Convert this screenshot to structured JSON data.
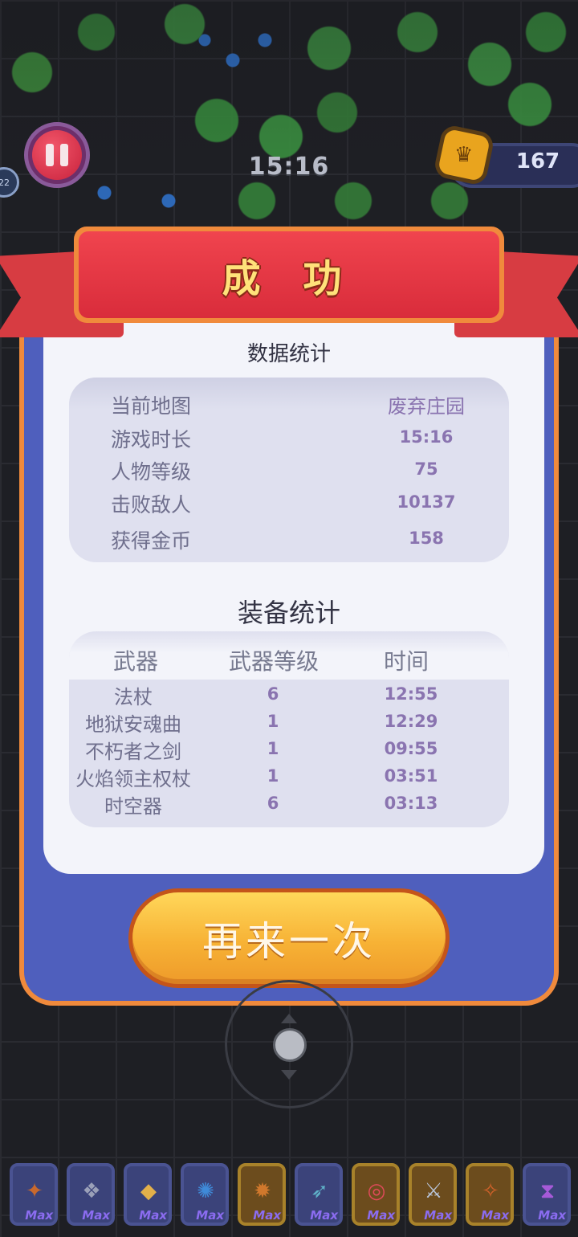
{
  "hud": {
    "timer": "15:16",
    "coins": "167",
    "side_chip": "22"
  },
  "result": {
    "title": "成 功",
    "stats_title": "数据统计",
    "stats": [
      {
        "label": "当前地图",
        "value": "废弃庄园"
      },
      {
        "label": "游戏时长",
        "value": "15:16"
      },
      {
        "label": "人物等级",
        "value": "75"
      },
      {
        "label": "击败敌人",
        "value": "10137"
      },
      {
        "label": "获得金币",
        "value": "158"
      }
    ],
    "equip_title": "装备统计",
    "equip_headers": [
      "武器",
      "武器等级",
      "时间"
    ],
    "equip_rows": [
      {
        "name": "法杖",
        "level": "6",
        "time": "12:55"
      },
      {
        "name": "地狱安魂曲",
        "level": "1",
        "time": "12:29"
      },
      {
        "name": "不朽者之剑",
        "level": "1",
        "time": "09:55"
      },
      {
        "name": "火焰领主权杖",
        "level": "1",
        "time": "03:51"
      },
      {
        "name": "时空器",
        "level": "6",
        "time": "03:13"
      }
    ],
    "again_label": "再来一次"
  },
  "skills": [
    {
      "icon": "boot-icon",
      "glyph": "✦",
      "max": "Max",
      "style": "blue",
      "color": "#c9692d"
    },
    {
      "icon": "wings-icon",
      "glyph": "❖",
      "max": "Max",
      "style": "blue",
      "color": "#9aa0b8"
    },
    {
      "icon": "crystal-icon",
      "glyph": "◆",
      "max": "Max",
      "style": "blue",
      "color": "#e3b04a"
    },
    {
      "icon": "vortex-icon",
      "glyph": "✺",
      "max": "Max",
      "style": "blue",
      "color": "#3f8ad8"
    },
    {
      "icon": "sun-orb-icon",
      "glyph": "✹",
      "max": "Max",
      "style": "gold",
      "color": "#d0782c"
    },
    {
      "icon": "spear-icon",
      "glyph": "➶",
      "max": "Max",
      "style": "blue",
      "color": "#5fb2c8"
    },
    {
      "icon": "ring-icon",
      "glyph": "◎",
      "max": "Max",
      "style": "gold",
      "color": "#e04a5a"
    },
    {
      "icon": "sword-icon",
      "glyph": "⚔",
      "max": "Max",
      "style": "gold",
      "color": "#b8c4d8"
    },
    {
      "icon": "torch-icon",
      "glyph": "✧",
      "max": "Max",
      "style": "gold",
      "color": "#d0612a"
    },
    {
      "icon": "hourglass-icon",
      "glyph": "⧗",
      "max": "Max",
      "style": "blue",
      "color": "#a65ad8"
    }
  ]
}
